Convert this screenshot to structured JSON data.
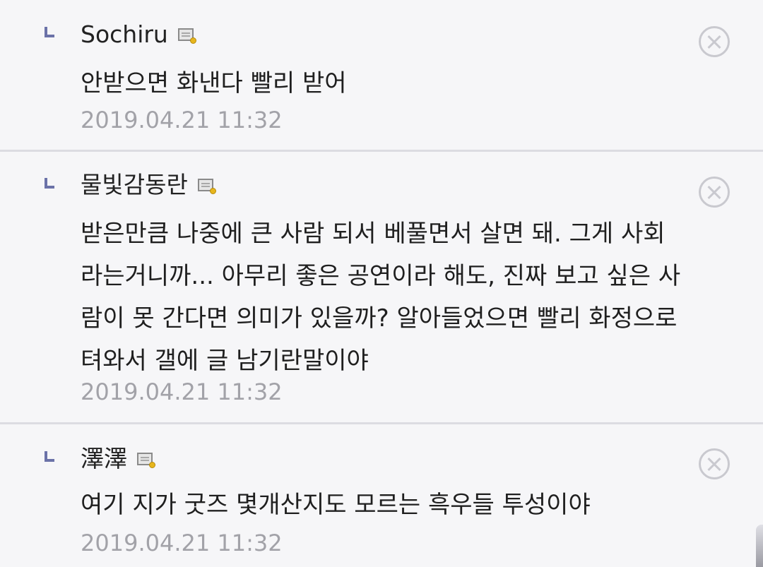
{
  "comments": [
    {
      "author": "Sochiru",
      "body": "안받으면 화낸다 빨리 받어",
      "timestamp": "2019.04.21 11:32",
      "author_icon": "memo-icon",
      "delete_icon": "close-circle-icon"
    },
    {
      "author": "물빛감동란",
      "body": "받은만큼 나중에 큰 사람 되서 베풀면서 살면 돼. 그게 사회\n라는거니까... 아무리 좋은 공연이라 해도, 진짜 보고 싶은 사\n람이 못 간다면 의미가 있을까? 알아들었으면 빨리 화정으로\n텨와서 갤에 글 남기란말이야",
      "timestamp": "2019.04.21 11:32",
      "author_icon": "memo-icon",
      "delete_icon": "close-circle-icon"
    },
    {
      "author": "澤澤",
      "body": "여기 지가 굿즈 몇개산지도 모르는 흑우들 투성이야",
      "timestamp": "2019.04.21 11:32",
      "author_icon": "memo-icon",
      "delete_icon": "close-circle-icon"
    }
  ],
  "colors": {
    "background": "#f6f6f8",
    "reply_mark": "#6b72a8",
    "timestamp": "#a2a2a8",
    "divider": "#dcdce2",
    "delete_icon": "#c9c9cf"
  }
}
